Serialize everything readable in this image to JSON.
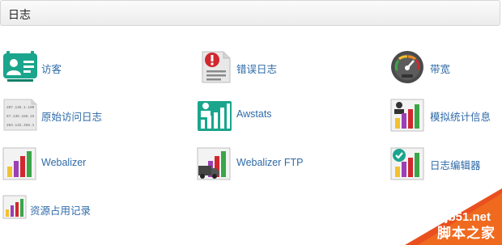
{
  "header": {
    "title": "日志"
  },
  "items": [
    {
      "label": "访客",
      "icon": "visitors-icon"
    },
    {
      "label": "错误日志",
      "icon": "error-log-icon"
    },
    {
      "label": "带宽",
      "icon": "bandwidth-gauge-icon"
    },
    {
      "label": "原始访问日志",
      "icon": "raw-access-log-icon"
    },
    {
      "label": "Awstats",
      "icon": "awstats-icon"
    },
    {
      "label": "模拟统计信息",
      "icon": "analog-stats-icon"
    },
    {
      "label": "Webalizer",
      "icon": "webalizer-icon"
    },
    {
      "label": "Webalizer FTP",
      "icon": "webalizer-ftp-icon"
    },
    {
      "label": "日志编辑器",
      "icon": "log-editor-icon"
    },
    {
      "label": "资源占用记录",
      "icon": "resource-usage-icon"
    }
  ],
  "raw_log_lines": [
    "207.136.1.100",
    "67.136.158.15",
    "203.132.456.1"
  ],
  "watermark": {
    "line1": "jb51.net",
    "line2": "脚本之家"
  },
  "colors": {
    "link": "#2e6aa8",
    "teal": "#1aa58c",
    "error_red": "#d0282e",
    "watermark_bg": "#e9501e"
  }
}
